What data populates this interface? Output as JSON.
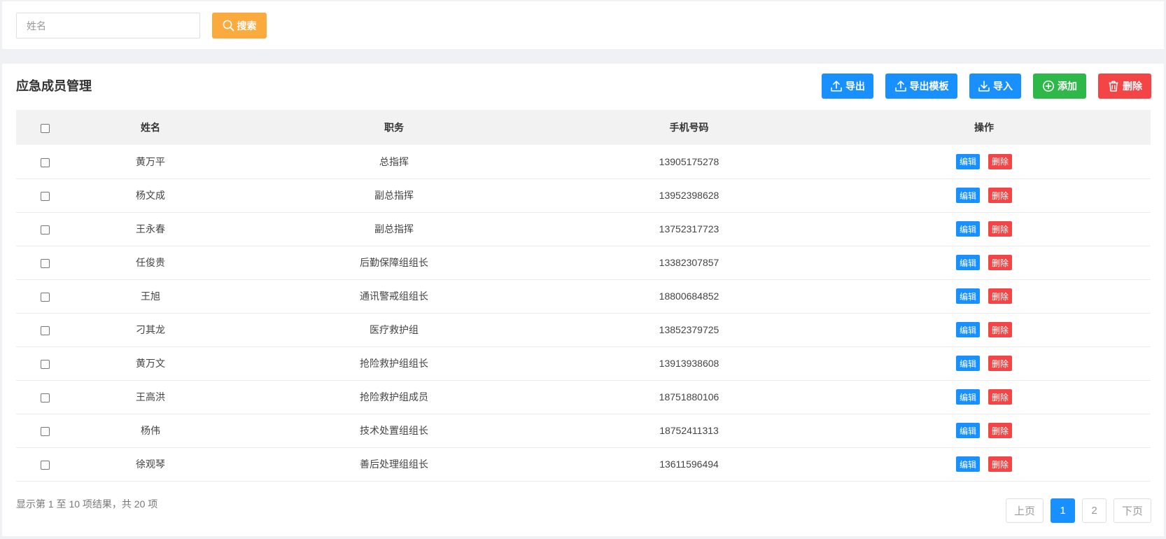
{
  "search": {
    "placeholder": "姓名",
    "button_label": "搜索"
  },
  "panel": {
    "title": "应急成员管理",
    "toolbar": {
      "export_label": "导出",
      "export_template_label": "导出模板",
      "import_label": "导入",
      "add_label": "添加",
      "delete_label": "删除"
    }
  },
  "table": {
    "headers": [
      "姓名",
      "职务",
      "手机号码",
      "操作"
    ],
    "edit_label": "编辑",
    "delete_label": "删除",
    "rows": [
      {
        "name": "黄万平",
        "title": "总指挥",
        "phone": "13905175278"
      },
      {
        "name": "杨文成",
        "title": "副总指挥",
        "phone": "13952398628"
      },
      {
        "name": "王永春",
        "title": "副总指挥",
        "phone": "13752317723"
      },
      {
        "name": "任俊贵",
        "title": "后勤保障组组长",
        "phone": "13382307857"
      },
      {
        "name": "王旭",
        "title": "通讯警戒组组长",
        "phone": "18800684852"
      },
      {
        "name": "刁其龙",
        "title": "医疗救护组",
        "phone": "13852379725"
      },
      {
        "name": "黄万文",
        "title": "抢险救护组组长",
        "phone": "13913938608"
      },
      {
        "name": "王高洪",
        "title": "抢险救护组成员",
        "phone": "18751880106"
      },
      {
        "name": "杨伟",
        "title": "技术处置组组长",
        "phone": "18752411313"
      },
      {
        "name": "徐观琴",
        "title": "善后处理组组长",
        "phone": "13611596494"
      }
    ]
  },
  "footer": {
    "summary": "显示第 1 至 10 项结果，共 20 项",
    "pagination": {
      "prev_label": "上页",
      "pages": [
        "1",
        "2"
      ],
      "current_page": "1",
      "next_label": "下页"
    }
  },
  "colors": {
    "primary": "#1890ff",
    "success": "#2fb84a",
    "danger": "#f34545",
    "warning": "#fbaa3d"
  }
}
